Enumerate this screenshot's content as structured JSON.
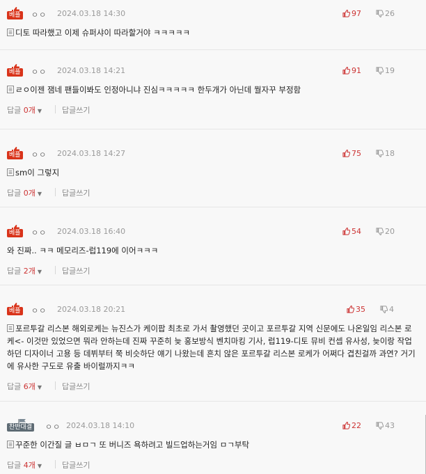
{
  "comments": [
    {
      "badge": "베플",
      "anon": "ㅇㅇ",
      "date": "2024.03.18 14:30",
      "up": "97",
      "down": "26",
      "text": "디토 따라했고 이제 슈퍼샤이 따라할거야 ㅋㅋㅋㅋㅋ",
      "show_doc_icon": true,
      "has_actions": false
    },
    {
      "badge": "베플",
      "anon": "ㅇㅇ",
      "date": "2024.03.18 14:21",
      "up": "91",
      "down": "19",
      "text": "ㄹㅇ이젠 잼네 팬들이봐도 인정아니냐 진심ㅋㅋㅋㅋㅋ 한두개가 아닌데 뭘자꾸 부정함",
      "show_doc_icon": true,
      "has_actions": true,
      "reply_label": "답글",
      "reply_count": "0개",
      "write_label": "답글쓰기"
    },
    {
      "badge": "베플",
      "anon": "ㅇㅇ",
      "date": "2024.03.18 14:27",
      "up": "75",
      "down": "18",
      "text": "sm이 그렇지",
      "show_doc_icon": true,
      "has_actions": true,
      "reply_label": "답글",
      "reply_count": "0개",
      "write_label": "답글쓰기"
    },
    {
      "badge": "베플",
      "anon": "ㅇㅇ",
      "date": "2024.03.18 16:40",
      "up": "54",
      "down": "20",
      "text": "와 진짜.. ㅋㅋ 메모리즈-럽119에 이어ㅋㅋㅋ",
      "show_doc_icon": false,
      "has_actions": true,
      "reply_label": "답글",
      "reply_count": "2개",
      "write_label": "답글쓰기"
    },
    {
      "badge": "베플",
      "anon": "ㅇㅇ",
      "date": "2024.03.18 20:21",
      "up": "35",
      "down": "4",
      "text": "포르투갈 리스본 해외로케는 뉴진스가 케이팝 최초로 가서 촬영했던 곳이고 포르투갈 지역 신문에도 나온일임 리스본 로케<- 이것만 있었으면 뭐라 안하는데 진짜 꾸준히 늦 홍보방식 벤치마킹 기사, 럽119-디토 뮤비 컨셉 유사성, 늦이랑 작업하던 디자이너 고용 등 데뷔부터 쭉 비슷하단 얘기 나왔는데 흔치 않은 포르투갈 리스본 로케가 어쩌다 겹친걸까 과연? 거기에 유사한 구도로 유출 바이럴까지ㅋㅋ",
      "show_doc_icon": true,
      "has_actions": true,
      "reply_label": "답글",
      "reply_count": "6개",
      "write_label": "답글쓰기"
    },
    {
      "badge": "찬반대결",
      "anon": "ㅇㅇ",
      "date": "2024.03.18 14:10",
      "up": "22",
      "down": "43",
      "text": "꾸준한 이간질 글 ㅂㅁㄱ 또 버니즈 욕하려고 빌드업하는거임 ㅁㄱ부탁",
      "show_doc_icon": true,
      "has_actions": true,
      "reply_label": "답글",
      "reply_count": "4개",
      "write_label": "답글쓰기"
    }
  ]
}
